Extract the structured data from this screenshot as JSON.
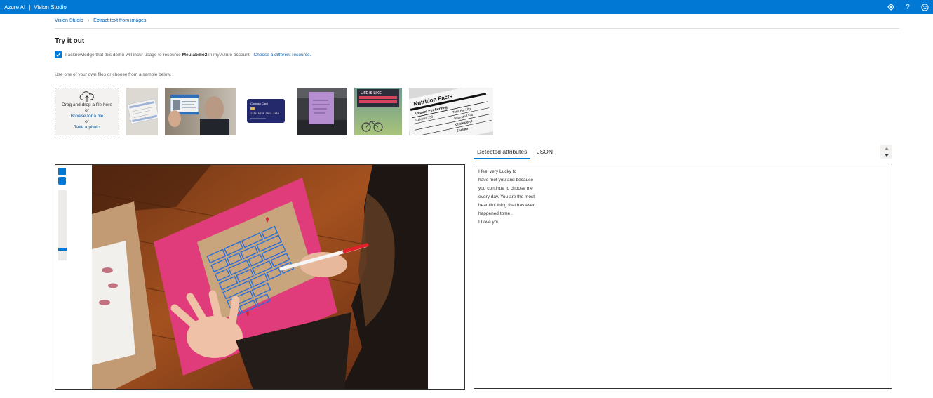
{
  "topbar": {
    "brand_left": "Azure AI",
    "brand_sep": "|",
    "brand_right": "Vision Studio",
    "icons": [
      "settings-icon",
      "help-icon",
      "feedback-smiley-icon"
    ],
    "help_glyph": "?"
  },
  "breadcrumb": {
    "items": [
      "Vision Studio",
      "Extract text from images"
    ]
  },
  "page": {
    "title": "Try it out",
    "ack_prefix": "I acknowledge that this demo will incur usage to resource",
    "ack_resource": "Meulabdio2",
    "ack_suffix": "in my Azure account.",
    "ack_link": "Choose a different resource.",
    "instructions": "Use one of your own files or choose from a sample below."
  },
  "upload": {
    "drag_text": "Drag and drop a file here",
    "or1": "or",
    "browse_link": "Browse for a file",
    "or2": "or",
    "photo_link": "Take a photo"
  },
  "samples": [
    "sample-social-security-card",
    "sample-id-badge",
    "sample-credit-card",
    "sample-sticky-note",
    "sample-street-sign",
    "sample-nutrition-facts"
  ],
  "sample_text": {
    "card_brand": "Contoso Card",
    "card_number": "1234 5678 9012 3456",
    "sign_text": "LIFE IS LIKE",
    "nutrition_title": "Nutrition Facts",
    "nutrition_rows": [
      "Amount Per Serving",
      "Calories 130",
      "Total Fat 10g",
      "Saturated Fat",
      "Cholesterol",
      "Sodium"
    ]
  },
  "results": {
    "tabs": [
      "Detected attributes",
      "JSON"
    ],
    "active_tab": 0,
    "lines": [
      "I feel very Lucky to",
      "have met you and because",
      "you continue to choose me",
      "every day. You are the most",
      "beautiful thing that has ever",
      "happened tome .",
      "I Love you"
    ]
  },
  "canvas": {
    "zoom_level": 0.85
  },
  "colors": {
    "accent": "#0078d4",
    "link": "#0f5ea8",
    "text": "#323130",
    "detection_box": "#2b6fd8"
  }
}
